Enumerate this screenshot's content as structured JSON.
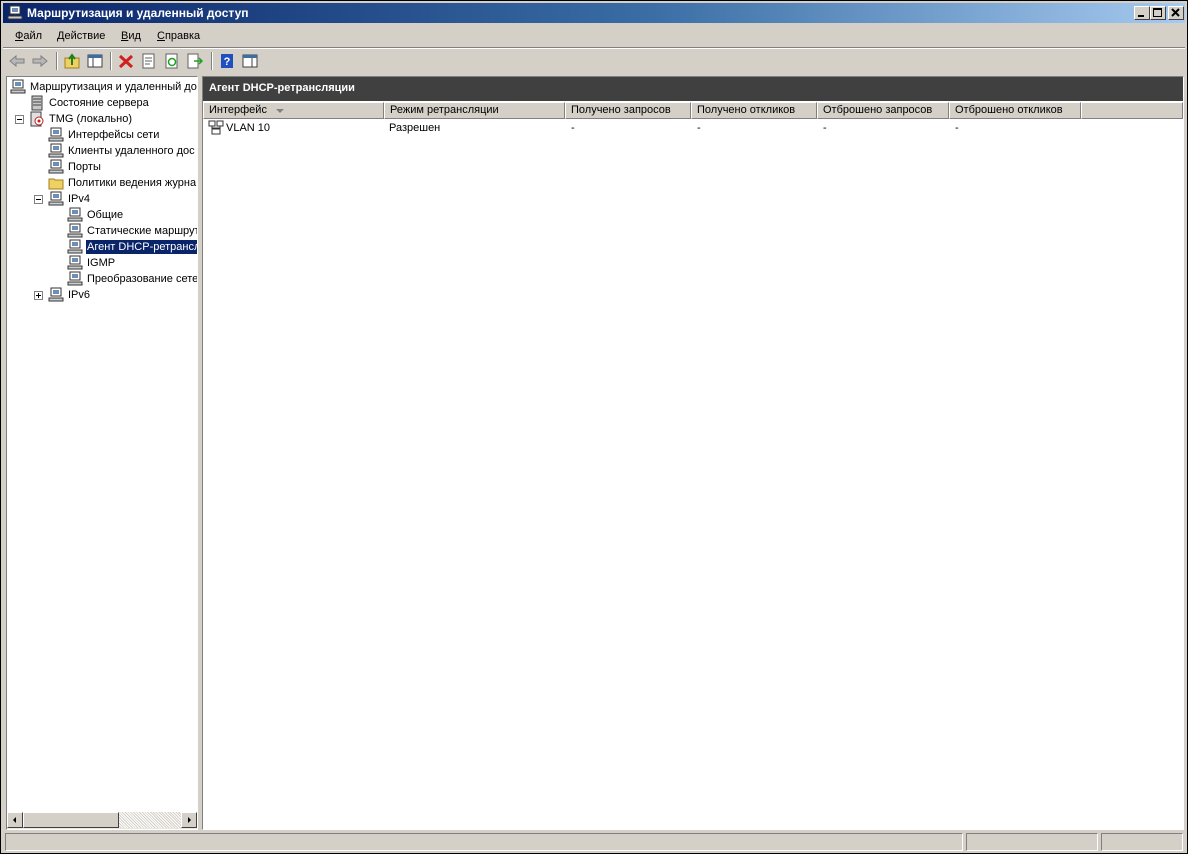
{
  "window": {
    "title": "Маршрутизация и удаленный доступ"
  },
  "menu": [
    {
      "label": "Файл",
      "accel": "Ф",
      "rest": "айл"
    },
    {
      "label": "Действие",
      "accel": "Д",
      "rest": "ействие"
    },
    {
      "label": "Вид",
      "accel": "В",
      "rest": "ид"
    },
    {
      "label": "Справка",
      "accel": "С",
      "rest": "правка"
    }
  ],
  "toolbar": {
    "icons": [
      "back-arrow-icon",
      "forward-arrow-icon",
      "up-folder-icon",
      "show-hide-tree-icon",
      "delete-icon",
      "properties-icon",
      "refresh-icon",
      "export-list-icon",
      "help-icon",
      "show-hide-action-pane-icon"
    ]
  },
  "tree": {
    "root": "Маршрутизация и удаленный до",
    "server_status": "Состояние сервера",
    "server": "TMG (локально)",
    "interfaces": "Интерфейсы сети",
    "remote_clients": "Клиенты удаленного дос",
    "ports": "Порты",
    "logging": "Политики ведения журна",
    "ipv4": "IPv4",
    "general": "Общие",
    "static_routes": "Статические маршрут",
    "dhcp_relay": "Агент DHCP-ретрансл",
    "igmp": "IGMP",
    "nat": "Преобразование сете",
    "ipv6": "IPv6"
  },
  "details": {
    "header": "Агент DHCP-ретрансляции",
    "columns": [
      "Интерфейс",
      "Режим ретрансляции",
      "Получено запросов",
      "Получено откликов",
      "Отброшено запросов",
      "Отброшено откликов"
    ],
    "rows": [
      [
        "VLAN 10",
        "Разрешен",
        "-",
        "-",
        "-",
        "-"
      ]
    ]
  }
}
